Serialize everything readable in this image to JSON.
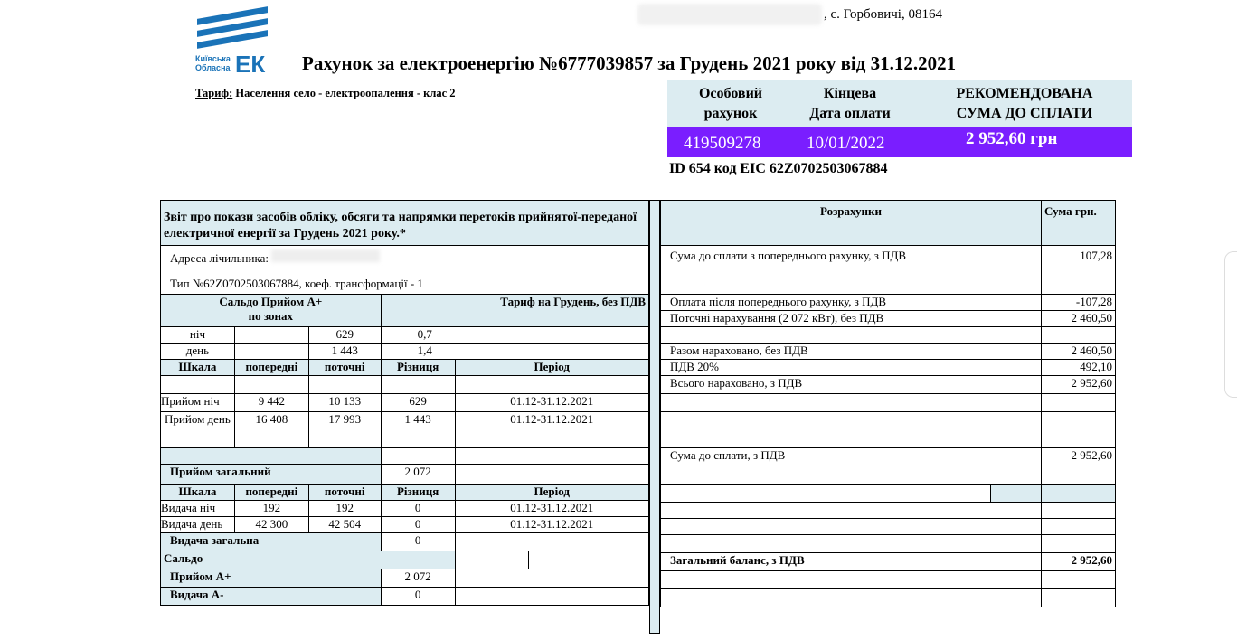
{
  "logo": {
    "line1": "Київська",
    "line2": "Обласна",
    "mark": "ЕК",
    "color": "#1a73b8"
  },
  "header": {
    "address": ", с. Горбовичі, 08164",
    "title": "Рахунок за електроенергію №6777039857 за Грудень 2021 року від 31.12.2021",
    "tariff_label": "Тариф:",
    "tariff_value": " Населення село - електроопалення  - клас 2"
  },
  "summary": {
    "col1": [
      "Особовий",
      "рахунок"
    ],
    "col2": [
      "Кінцева",
      "Дата оплати"
    ],
    "col3": [
      "РЕКОМЕНДОВАНА",
      "СУМА ДО СПЛАТИ"
    ],
    "account": "419509278",
    "due_date": "10/01/2022",
    "amount": "2 952,60 грн",
    "highlight_color": "#7a1eff",
    "id_line": "ID 654 код EIC 62Z0702503067884"
  },
  "left": {
    "title": "Звіт про покази засобів обліку, обсяги та напрямки перетоків прийнятої-переданої електричної енергії за Грудень  2021 року.*",
    "meter_address_label": "Адреса лічильника:",
    "type_line": "Тип  №62Z0702503067884,  коеф. трансформації - 1",
    "saldo_head": "Сальдо Прийом А+",
    "by_zones": "по зонах",
    "tariff_head": "Тариф на Грудень, без ПДВ",
    "zones": [
      {
        "name": "ніч",
        "value": "629",
        "tariff": "0,7"
      },
      {
        "name": "день",
        "value": "1 443",
        "tariff": "1,4"
      }
    ],
    "cols": [
      "Шкала",
      "попередні",
      "поточні",
      "Різниця",
      "Період"
    ],
    "intake": [
      {
        "name": "Прийом ніч",
        "prev": "9 442",
        "cur": "10 133",
        "diff": "629",
        "period": "01.12-31.12.2021"
      },
      {
        "name": "Прийом день",
        "prev": "16 408",
        "cur": "17 993",
        "diff": "1 443",
        "period": "01.12-31.12.2021"
      }
    ],
    "intake_total_label": "Прийом загальний",
    "intake_total": "2 072",
    "output": [
      {
        "name": "Видача ніч",
        "prev": "192",
        "cur": "192",
        "diff": "0",
        "period": "01.12-31.12.2021"
      },
      {
        "name": "Видача день",
        "prev": "42 300",
        "cur": "42 504",
        "diff": "0",
        "period": "01.12-31.12.2021"
      }
    ],
    "output_total_label": "Видача загальна",
    "output_total": "0",
    "saldo": "Сальдо",
    "intake_a_label": "Прийом А+",
    "intake_a": "2 072",
    "output_a_label": "Видача А-",
    "output_a": "0"
  },
  "right": {
    "head": "Розрахунки",
    "sum_head": "Сума грн.",
    "rows": [
      {
        "label": "Сума до сплати з попереднього рахунку, з ПДВ",
        "value": "107,28"
      },
      {
        "label": "Оплата після попереднього рахунку, з ПДВ",
        "value": "-107,28"
      },
      {
        "label": "Поточні нарахування  (2 072 кВт), без ПДВ",
        "value": "2 460,50"
      },
      {
        "label": "Разом нараховано, без ПДВ",
        "value": "2 460,50"
      },
      {
        "label": "ПДВ  20%",
        "value": "492,10"
      },
      {
        "label": "Всього нараховано, з ПДВ",
        "value": "2 952,60"
      },
      {
        "label": "Сума до сплати, з ПДВ",
        "value": "2 952,60"
      },
      {
        "label": "Загальний баланс, з ПДВ",
        "value": "2 952,60"
      }
    ]
  }
}
